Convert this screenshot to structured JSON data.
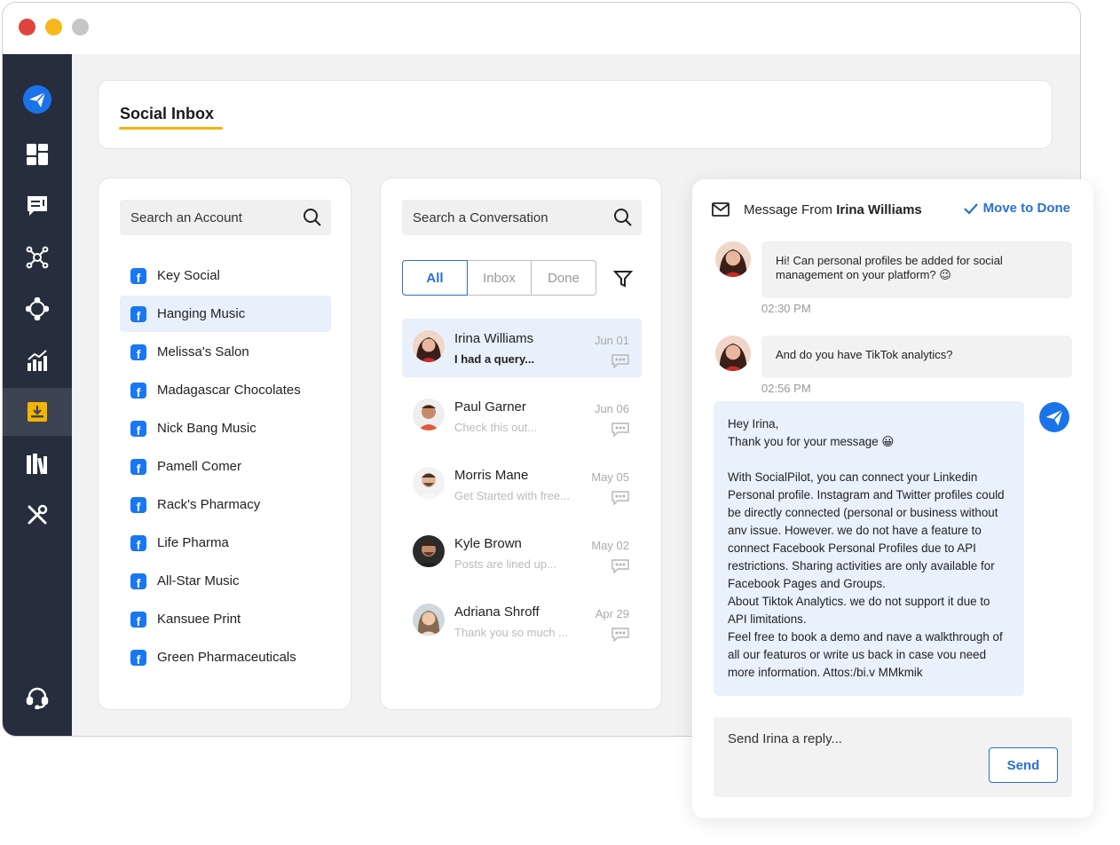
{
  "header": {
    "title": "Social Inbox"
  },
  "accounts": {
    "search_placeholder": "Search an Account",
    "items": [
      {
        "label": "Key Social"
      },
      {
        "label": "Hanging Music"
      },
      {
        "label": "Melissa's Salon"
      },
      {
        "label": "Madagascar Chocolates"
      },
      {
        "label": "Nick Bang Music"
      },
      {
        "label": "Pamell Comer"
      },
      {
        "label": "Rack's Pharmacy"
      },
      {
        "label": "Life Pharma"
      },
      {
        "label": "All-Star Music"
      },
      {
        "label": "Kansuee Print"
      },
      {
        "label": "Green Pharmaceuticals"
      }
    ],
    "selected": "Hanging Music"
  },
  "conversations": {
    "search_placeholder": "Search a Conversation",
    "tabs": [
      "All",
      "Inbox",
      "Done"
    ],
    "active_tab": "All",
    "items": [
      {
        "name": "Irina Williams",
        "snippet": "I had a query...",
        "date": "Jun 01"
      },
      {
        "name": "Paul Garner",
        "snippet": "Check this out...",
        "date": "Jun 06"
      },
      {
        "name": "Morris Mane",
        "snippet": "Get Started with free...",
        "date": "May 05"
      },
      {
        "name": "Kyle Brown",
        "snippet": "Posts are lined up...",
        "date": "May 02"
      },
      {
        "name": "Adriana Shroff",
        "snippet": "Thank you so much ...",
        "date": "Apr 29"
      }
    ]
  },
  "message_panel": {
    "from_prefix": "Message From",
    "from_name": "Irina Williams",
    "move_to_done": "Move to Done",
    "messages": [
      {
        "text": "Hi! Can personal profiles be added for social management on your platform? 😉",
        "time": "02:30 PM"
      },
      {
        "text": "And do you have TikTok analytics?",
        "time": "02:56 PM"
      }
    ],
    "reply": "Hey Irina,\nThank you for your message 😀\n\nWith SocialPilot, you can connect your Linkedin Personal profile. Instagram and Twitter profiles could be directly connected (personal or business without anv issue. However. we do not have a feature to connect Facebook Personal Profiles due to API restrictions. Sharing activities are only available for Facebook Pages and Groups.\nAbout Tiktok Analytics. we do not support it due to API limitations.\nFeel free to book a demo and nave a walkthrough of all our featuros or write us back in case vou need more information. Attos:/bi.v MMkmik",
    "reply_placeholder": "Send Irina a reply...",
    "send_label": "Send"
  },
  "colors": {
    "accent": "#2a6fd6",
    "sidebar": "#262d3d",
    "highlight": "#f4b400",
    "facebook": "#1877f2"
  }
}
